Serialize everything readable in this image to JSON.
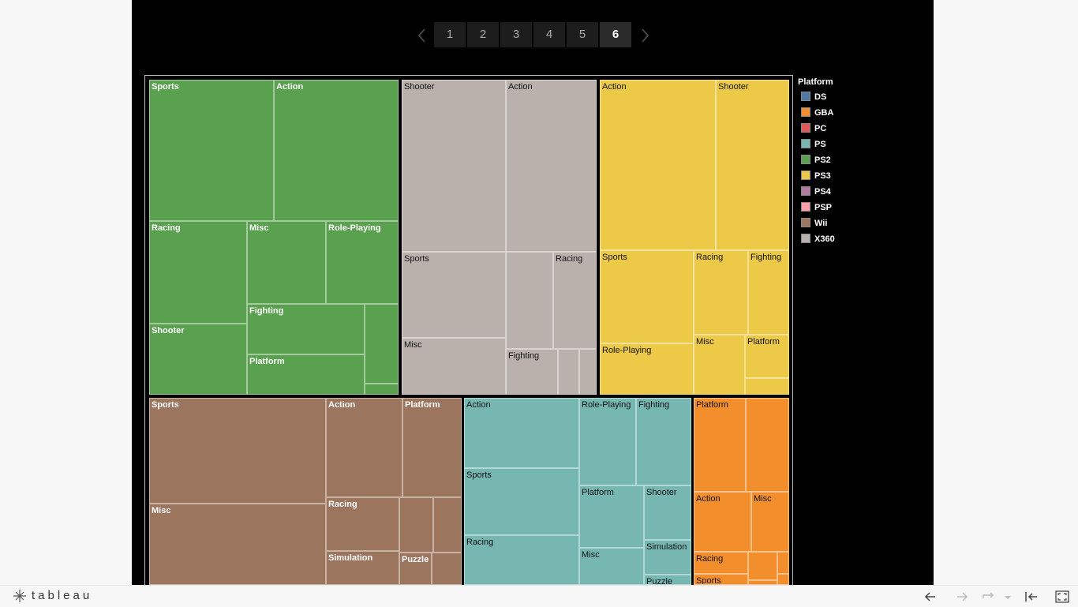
{
  "pagination": {
    "pages": [
      "1",
      "2",
      "3",
      "4",
      "5",
      "6"
    ],
    "current": "6"
  },
  "legend": {
    "title": "Platform",
    "items": [
      {
        "label": "DS",
        "color": "#4e79a7"
      },
      {
        "label": "GBA",
        "color": "#f28e2b"
      },
      {
        "label": "PC",
        "color": "#e15759"
      },
      {
        "label": "PS",
        "color": "#76b7b2"
      },
      {
        "label": "PS2",
        "color": "#59a14f"
      },
      {
        "label": "PS3",
        "color": "#edc948"
      },
      {
        "label": "PS4",
        "color": "#b07aa1"
      },
      {
        "label": "PSP",
        "color": "#ff9da7"
      },
      {
        "label": "Wii",
        "color": "#9c755f"
      },
      {
        "label": "X360",
        "color": "#bab0ac"
      }
    ]
  },
  "treemap": {
    "groups": [
      {
        "platform": "PS2",
        "genres": [
          "Sports",
          "Action",
          "Racing",
          "Misc",
          "Role-Playing",
          "Fighting",
          "Shooter",
          "Platform"
        ]
      },
      {
        "platform": "X360",
        "genres": [
          "Shooter",
          "Action",
          "Sports",
          "Racing",
          "Misc",
          "Fighting"
        ]
      },
      {
        "platform": "PS3",
        "genres": [
          "Action",
          "Shooter",
          "Sports",
          "Racing",
          "Fighting",
          "Role-Playing",
          "Misc",
          "Platform"
        ]
      },
      {
        "platform": "Wii",
        "genres": [
          "Sports",
          "Action",
          "Platform",
          "Misc",
          "Racing",
          "Simulation",
          "Puzzle"
        ]
      },
      {
        "platform": "PS",
        "genres": [
          "Action",
          "Role-Playing",
          "Fighting",
          "Sports",
          "Platform",
          "Shooter",
          "Racing",
          "Misc",
          "Simulation",
          "Puzzle"
        ]
      },
      {
        "platform": "GBA",
        "genres": [
          "Platform",
          "Action",
          "Misc",
          "Racing",
          "Sports"
        ]
      }
    ]
  },
  "toolbar": {
    "brand": "tableau"
  }
}
